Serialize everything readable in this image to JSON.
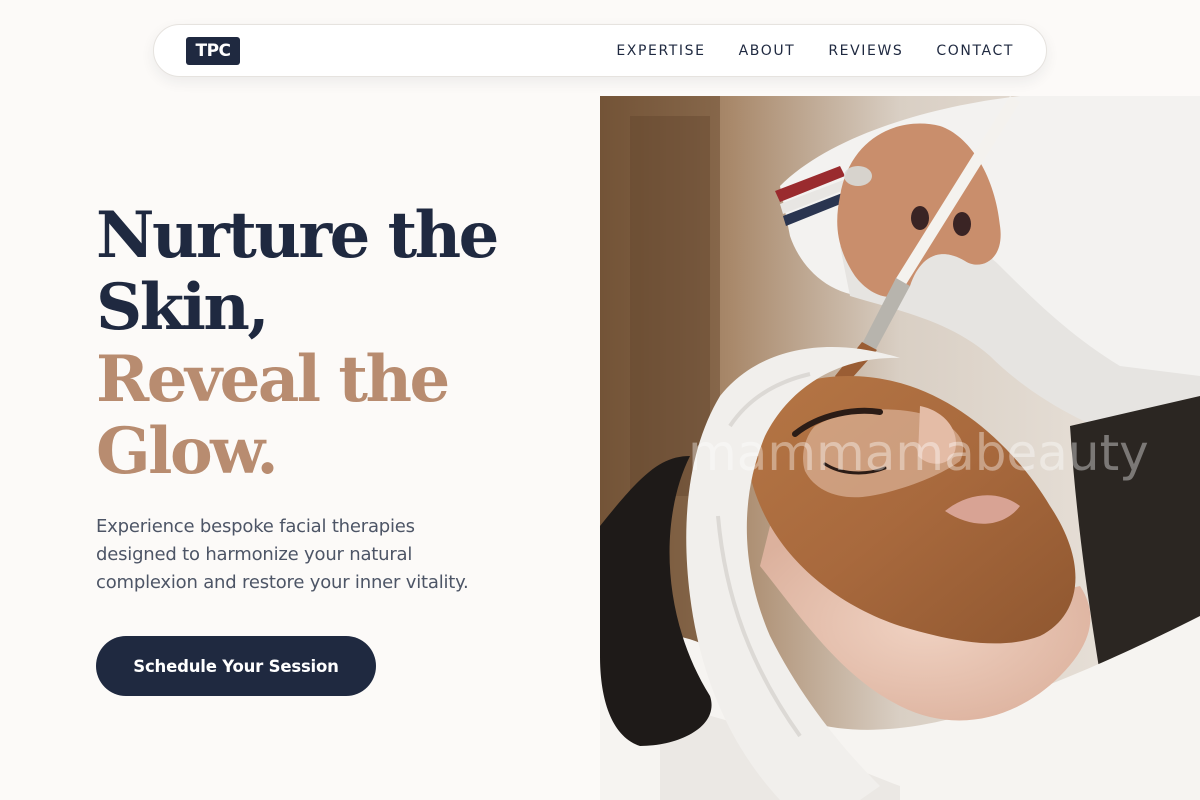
{
  "brand": {
    "logo_text": "TPC"
  },
  "nav": {
    "links": [
      {
        "label": "EXPERTISE"
      },
      {
        "label": "ABOUT"
      },
      {
        "label": "REVIEWS"
      },
      {
        "label": "CONTACT"
      }
    ]
  },
  "hero": {
    "title_lines": [
      "Nurture the",
      "Skin,",
      "Reveal the",
      "Glow."
    ],
    "subtitle_lines": [
      "Experience bespoke facial therapies",
      "designed to harmonize your natural",
      "complexion and restore your inner vitality."
    ],
    "cta_label": "Schedule Your Session",
    "image": {
      "description_icon": "facial-treatment-photo",
      "watermark": "mammamabeauty"
    }
  },
  "colors": {
    "navy": "#1f2940",
    "accent": "#b88c70",
    "background": "#fcfaf8",
    "body_text": "#4d5566"
  }
}
